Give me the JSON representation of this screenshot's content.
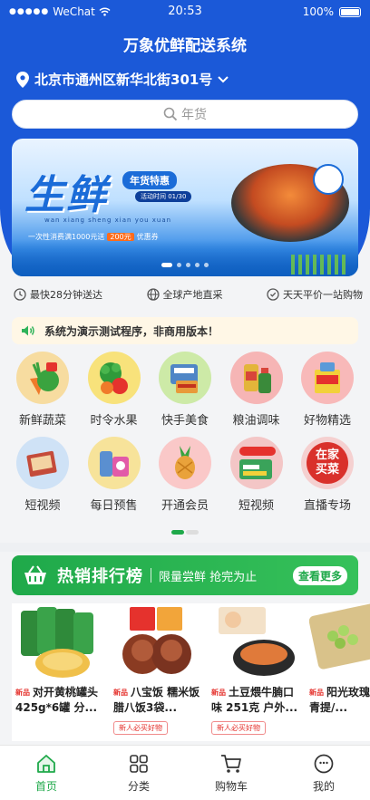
{
  "status": {
    "carrier": "WeChat",
    "time": "20:53",
    "battery": "100%"
  },
  "header": {
    "title": "万象优鲜配送系统",
    "location": "北京市通州区新华北街301号",
    "search_placeholder": "年货"
  },
  "banner": {
    "headline": "生鲜",
    "tag": "年货特惠",
    "subtag": "活动时间 01/30",
    "romanization": "wan xiang sheng xian you xuan",
    "promo_prefix": "一次性消费满1000元送",
    "promo_badge": "200元",
    "promo_suffix": "优惠券",
    "slides": 5,
    "active_slide": 0
  },
  "features": [
    {
      "icon": "clock-icon",
      "label": "最快28分钟送达"
    },
    {
      "icon": "globe-icon",
      "label": "全球产地直采"
    },
    {
      "icon": "shield-icon",
      "label": "天天平价一站购物"
    }
  ],
  "notice": {
    "text": "系统为演示测试程序，非商用版本！"
  },
  "categories": [
    {
      "label": "新鲜蔬菜",
      "bg": "#f7dca0",
      "color": "#e46a2a"
    },
    {
      "label": "时令水果",
      "bg": "#f8e27b",
      "color": "#2f9a3a"
    },
    {
      "label": "快手美食",
      "bg": "#cdeaa7",
      "color": "#4f86c6"
    },
    {
      "label": "粮油调味",
      "bg": "#f6b5b5",
      "color": "#d8a13a"
    },
    {
      "label": "好物精选",
      "bg": "#f8b9b9",
      "color": "#e0b23a"
    },
    {
      "label": "短视频",
      "bg": "#cfe2f6",
      "color": "#c44b3a"
    },
    {
      "label": "每日预售",
      "bg": "#f7e39a",
      "color": "#5a8fd0"
    },
    {
      "label": "开通会员",
      "bg": "#fac8c8",
      "color": "#e9a23b"
    },
    {
      "label": "短视频",
      "bg": "#f3c6c6",
      "color": "#3aa35a"
    },
    {
      "label": "直播专场",
      "bg": "#f5d0d0",
      "color": "#d93a3a"
    }
  ],
  "live_badge": {
    "line1": "在家",
    "line2": "买菜"
  },
  "pager": {
    "pages": 2,
    "active": 0
  },
  "ranking": {
    "title": "热销排行榜",
    "subtitle": "限量尝鲜 抢完为止",
    "more": "查看更多"
  },
  "products": [
    {
      "badge": "新品",
      "name": "对开黄桃罐头425g*6罐 分...",
      "chip": ""
    },
    {
      "badge": "新品",
      "name": "八宝饭 糯米饭腊八饭3袋...",
      "chip": "新人必买好物"
    },
    {
      "badge": "新品",
      "name": "土豆煨牛腩口味 251克 户外...",
      "chip": "新人必买好物"
    },
    {
      "badge": "新品",
      "name": "阳光玫瑰葡萄/青提/...",
      "chip": ""
    }
  ],
  "tabbar": [
    {
      "label": "首页",
      "icon": "home-icon",
      "active": true
    },
    {
      "label": "分类",
      "icon": "grid-icon",
      "active": false
    },
    {
      "label": "购物车",
      "icon": "cart-icon",
      "active": false
    },
    {
      "label": "我的",
      "icon": "user-icon",
      "active": false
    }
  ],
  "colors": {
    "primary_blue": "#1b59d8",
    "accent_green": "#1fa94a",
    "new_red": "#e5322d"
  }
}
